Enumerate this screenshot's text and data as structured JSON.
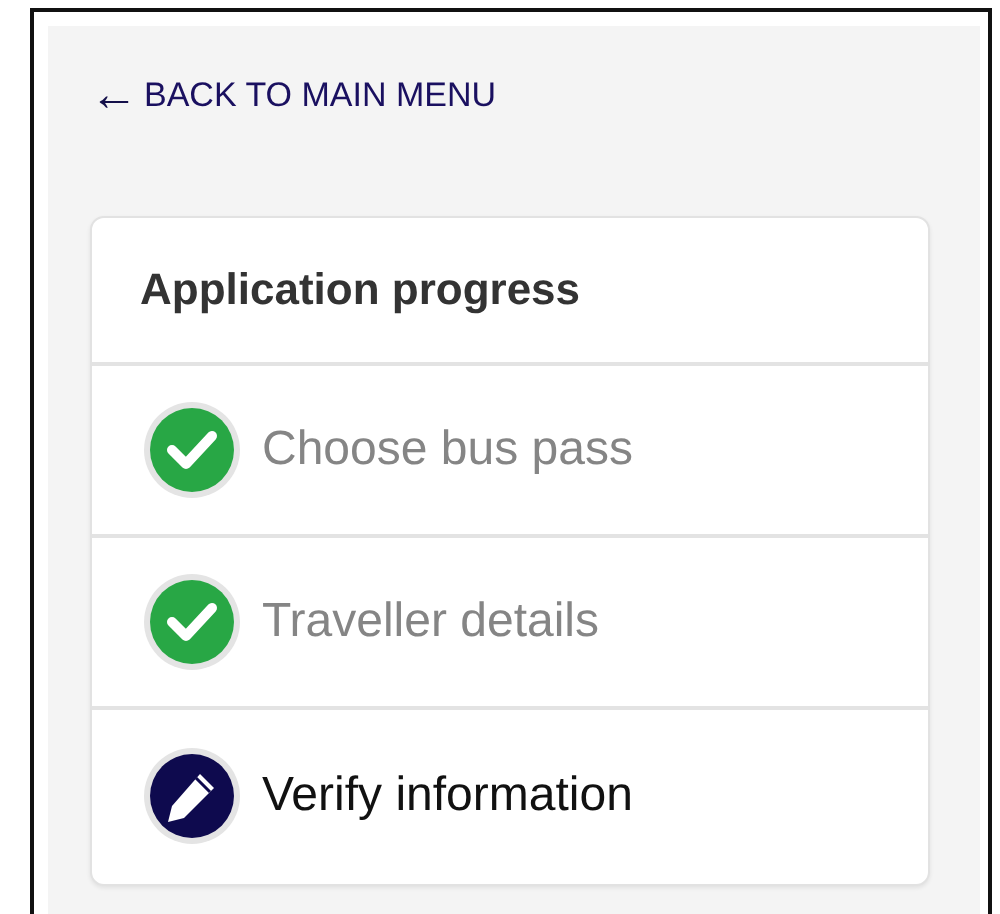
{
  "back_link": {
    "arrow": "←",
    "label": "BACK TO MAIN MENU"
  },
  "progress": {
    "title": "Application progress",
    "steps": [
      {
        "label": "Choose bus pass",
        "kind": "done"
      },
      {
        "label": "Traveller details",
        "kind": "done"
      },
      {
        "label": "Verify information",
        "kind": "current"
      }
    ]
  }
}
